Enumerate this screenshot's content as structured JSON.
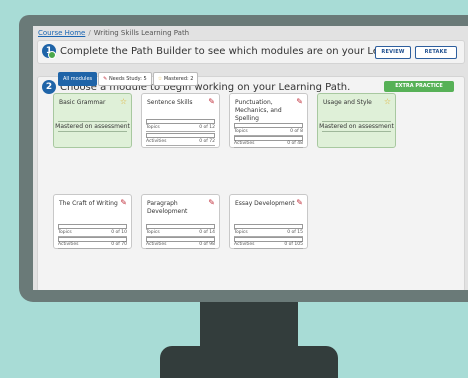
{
  "breadcrumb": {
    "home": "Course Home",
    "separator": "/",
    "current": "Writing Skills Learning Path"
  },
  "step1": {
    "number": "1",
    "text": "Complete the Path Builder to see which modules are on your Learning Path.",
    "review_label": "REVIEW",
    "retake_label": "RETAKE"
  },
  "step2": {
    "number": "2",
    "text": "Choose a module to begin working on your Learning Path.",
    "extra_practice_label": "EXTRA PRACTICE",
    "filters": {
      "all": "All modules",
      "needs": "Needs Study: 5",
      "mastered": "Mastered: 2"
    }
  },
  "labels": {
    "topics": "Topics",
    "activities": "Activities",
    "mastered": "Mastered on assessment"
  },
  "modules": [
    {
      "title": "Basic Grammar",
      "status": "mastered"
    },
    {
      "title": "Sentence Skills",
      "status": "needs",
      "topics": "0 of 12",
      "activities": "0 of 72"
    },
    {
      "title": "Punctuation, Mechanics, and Spelling",
      "status": "needs",
      "topics": "0 of 8",
      "activities": "0 of 48"
    },
    {
      "title": "Usage and Style",
      "status": "mastered"
    },
    {
      "title": "The Craft of Writing",
      "status": "needs",
      "topics": "0 of 10",
      "activities": "0 of 70"
    },
    {
      "title": "Paragraph Development",
      "status": "needs",
      "topics": "0 of 14",
      "activities": "0 of 98"
    },
    {
      "title": "Essay Development",
      "status": "needs",
      "topics": "0 of 15",
      "activities": "0 of 105"
    }
  ],
  "colors": {
    "accent": "#1f64a8",
    "mastered_bg": "#dff0d8",
    "needs_icon": "#c0303c",
    "star": "#e0b030",
    "extra": "#57b157"
  }
}
